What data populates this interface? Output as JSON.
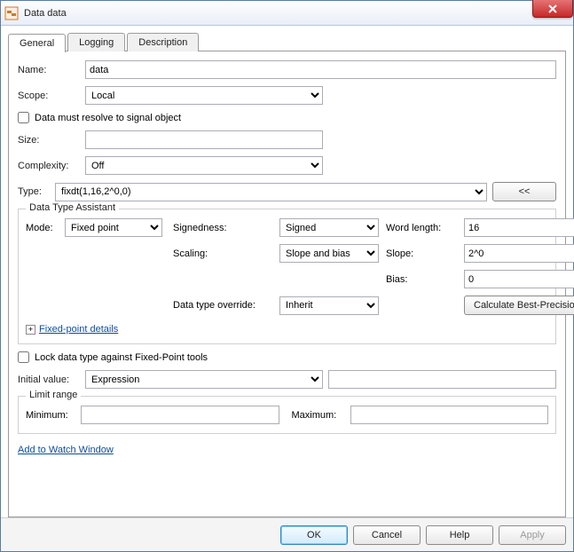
{
  "window": {
    "title": "Data data"
  },
  "tabs": {
    "general": "General",
    "logging": "Logging",
    "description": "Description"
  },
  "labels": {
    "name": "Name:",
    "scope": "Scope:",
    "resolve": "Data must resolve to signal object",
    "size": "Size:",
    "complexity": "Complexity:",
    "type": "Type:",
    "collapse": "<<",
    "dta_group": "Data Type Assistant",
    "mode": "Mode:",
    "signedness": "Signedness:",
    "wordlength": "Word length:",
    "scaling": "Scaling:",
    "slope": "Slope:",
    "bias": "Bias:",
    "override": "Data type override:",
    "calc": "Calculate Best-Precision Scaling",
    "fpdetails": "Fixed-point details",
    "lock": "Lock data type against Fixed-Point tools",
    "initvalue": "Initial value:",
    "limitrange": "Limit range",
    "minimum": "Minimum:",
    "maximum": "Maximum:",
    "watch": "Add to Watch Window"
  },
  "values": {
    "name": "data",
    "scope": "Local",
    "size": "",
    "complexity": "Off",
    "type": "fixdt(1,16,2^0,0)",
    "mode": "Fixed point",
    "signedness": "Signed",
    "wordlength": "16",
    "scaling": "Slope and bias",
    "slope": "2^0",
    "bias": "0",
    "override": "Inherit",
    "initvalue_mode": "Expression",
    "initvalue": "",
    "minimum": "",
    "maximum": ""
  },
  "footer": {
    "ok": "OK",
    "cancel": "Cancel",
    "help": "Help",
    "apply": "Apply"
  }
}
